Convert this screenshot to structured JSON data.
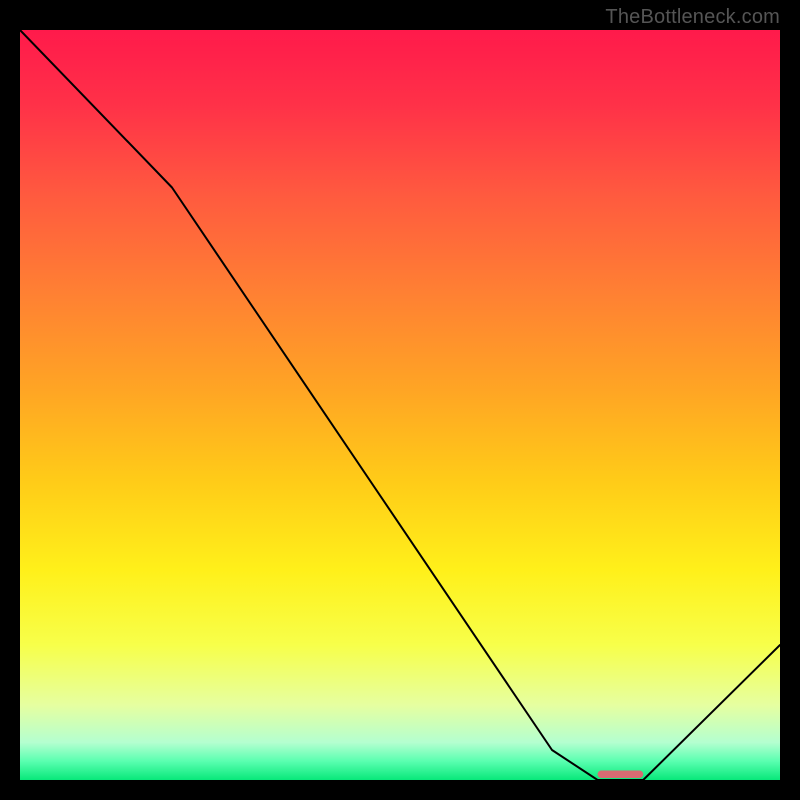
{
  "watermark": "TheBottleneck.com",
  "chart_data": {
    "type": "line",
    "title": "",
    "xlabel": "",
    "ylabel": "",
    "xlim": [
      0,
      100
    ],
    "ylim": [
      0,
      100
    ],
    "series": [
      {
        "name": "curve",
        "x": [
          0,
          20,
          70,
          76,
          82,
          100
        ],
        "y": [
          100,
          79,
          4,
          0,
          0,
          18
        ],
        "stroke": "#000000",
        "stroke_width": 2
      }
    ],
    "marker": {
      "x_start": 76,
      "x_end": 82,
      "y": 0,
      "color": "#d86b72",
      "height_frac": 0.01
    },
    "background_gradient": {
      "stops": [
        {
          "offset": 0.0,
          "color": "#ff1a4b"
        },
        {
          "offset": 0.1,
          "color": "#ff3148"
        },
        {
          "offset": 0.22,
          "color": "#ff5a3f"
        },
        {
          "offset": 0.35,
          "color": "#ff8033"
        },
        {
          "offset": 0.48,
          "color": "#ffa524"
        },
        {
          "offset": 0.6,
          "color": "#ffcb18"
        },
        {
          "offset": 0.72,
          "color": "#fff01a"
        },
        {
          "offset": 0.82,
          "color": "#f7ff4a"
        },
        {
          "offset": 0.9,
          "color": "#e6ffa0"
        },
        {
          "offset": 0.95,
          "color": "#b4ffd0"
        },
        {
          "offset": 0.975,
          "color": "#5affb0"
        },
        {
          "offset": 1.0,
          "color": "#08e87a"
        }
      ]
    }
  }
}
